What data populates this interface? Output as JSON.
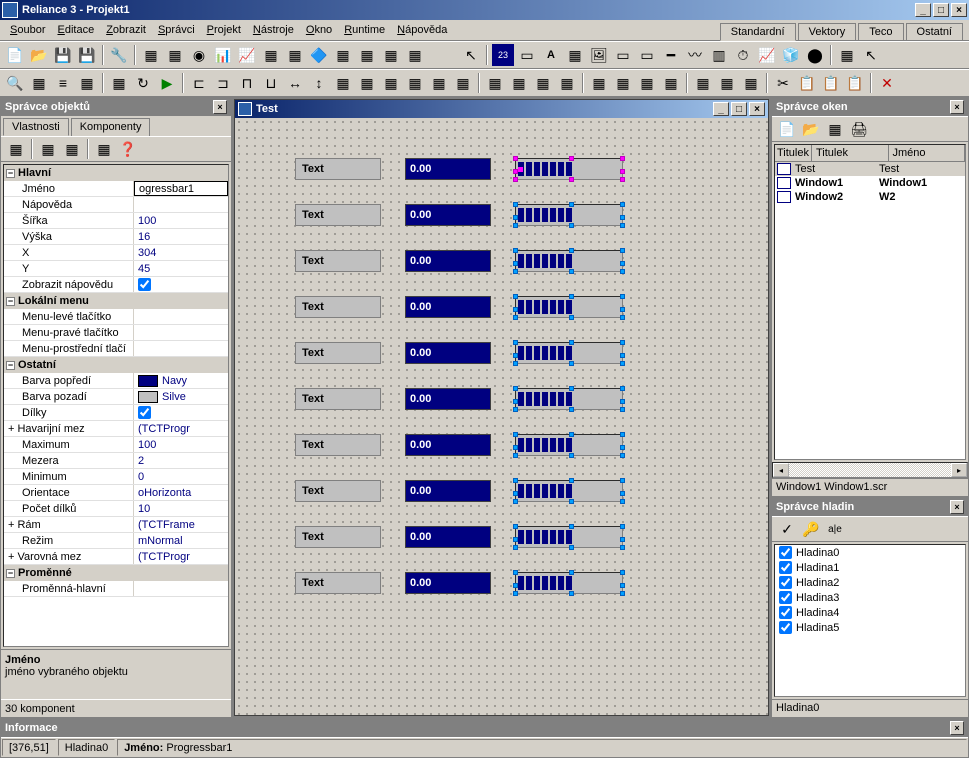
{
  "app": {
    "title": "Reliance 3 - Projekt1"
  },
  "menu": [
    "Soubor",
    "Editace",
    "Zobrazit",
    "Správci",
    "Projekt",
    "Nástroje",
    "Okno",
    "Runtime",
    "Nápověda"
  ],
  "comp_tabs": [
    "Standardní",
    "Vektory",
    "Teco",
    "Ostatní"
  ],
  "left": {
    "title": "Správce objektů",
    "tabs": [
      "Vlastnosti",
      "Komponenty"
    ],
    "sections": [
      {
        "name": "Hlavní",
        "rows": [
          {
            "k": "Jméno",
            "v": "ogressbar1",
            "editable": true
          },
          {
            "k": "Nápověda",
            "v": ""
          },
          {
            "k": "Šířka",
            "v": "100"
          },
          {
            "k": "Výška",
            "v": "16"
          },
          {
            "k": "X",
            "v": "304"
          },
          {
            "k": "Y",
            "v": "45"
          },
          {
            "k": "Zobrazit nápovědu",
            "v": "check"
          }
        ]
      },
      {
        "name": "Lokální menu",
        "rows": [
          {
            "k": "Menu-levé tlačítko",
            "v": ""
          },
          {
            "k": "Menu-pravé tlačítko",
            "v": ""
          },
          {
            "k": "Menu-prostřední tlačí",
            "v": ""
          }
        ]
      },
      {
        "name": "Ostatní",
        "rows": [
          {
            "k": "Barva popředí",
            "v": "Navy",
            "color": "#000080"
          },
          {
            "k": "Barva pozadí",
            "v": "Silve",
            "color": "#c0c0c0"
          },
          {
            "k": "Dílky",
            "v": "check"
          },
          {
            "k": "Havarijní mez",
            "v": "(TCTProgr",
            "exp": true
          },
          {
            "k": "Maximum",
            "v": "100"
          },
          {
            "k": "Mezera",
            "v": "2"
          },
          {
            "k": "Minimum",
            "v": "0"
          },
          {
            "k": "Orientace",
            "v": "oHorizonta"
          },
          {
            "k": "Počet dílků",
            "v": "10"
          },
          {
            "k": "Rám",
            "v": "(TCTFrame",
            "exp": true
          },
          {
            "k": "Režim",
            "v": "mNormal"
          },
          {
            "k": "Varovná mez",
            "v": "(TCTProgr",
            "exp": true
          }
        ]
      },
      {
        "name": "Proměnné",
        "rows": [
          {
            "k": "Proměnná-hlavní",
            "v": ""
          }
        ]
      }
    ],
    "help_title": "Jméno",
    "help_text": "jméno vybraného objektu",
    "status": "30 komponent"
  },
  "design": {
    "window_title": "Test",
    "rows": [
      {
        "text": "Text",
        "display": "0.00",
        "selected": true
      },
      {
        "text": "Text",
        "display": "0.00"
      },
      {
        "text": "Text",
        "display": "0.00"
      },
      {
        "text": "Text",
        "display": "0.00"
      },
      {
        "text": "Text",
        "display": "0.00"
      },
      {
        "text": "Text",
        "display": "0.00"
      },
      {
        "text": "Text",
        "display": "0.00"
      },
      {
        "text": "Text",
        "display": "0.00"
      },
      {
        "text": "Text",
        "display": "0.00"
      },
      {
        "text": "Text",
        "display": "0.00"
      }
    ]
  },
  "win_mgr": {
    "title": "Správce oken",
    "cols": [
      "Titulek",
      "Jméno"
    ],
    "rows": [
      {
        "t": "Test",
        "n": "Test",
        "sel": true
      },
      {
        "t": "Window1",
        "n": "Window1",
        "bold": true
      },
      {
        "t": "Window2",
        "n": "W2",
        "bold": true
      }
    ],
    "status": "Window1  Window1.scr"
  },
  "layer_mgr": {
    "title": "Správce hladin",
    "layers": [
      "Hladina0",
      "Hladina1",
      "Hladina2",
      "Hladina3",
      "Hladina4",
      "Hladina5"
    ],
    "status": "Hladina0"
  },
  "info": {
    "title": "Informace",
    "coords": "[376,51]",
    "layer": "Hladina0",
    "name_label": "Jméno:",
    "name_value": "Progressbar1"
  }
}
